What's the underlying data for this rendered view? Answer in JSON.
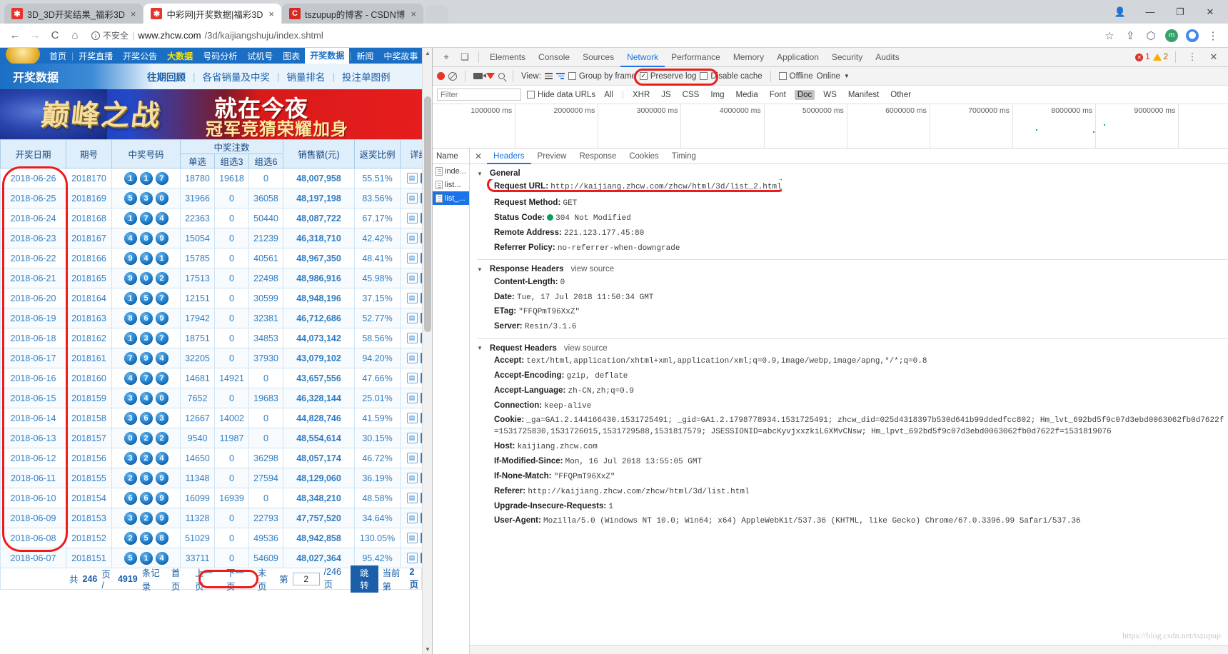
{
  "browser": {
    "tabs": [
      {
        "title": "3D_3D开奖结果_福彩3D",
        "favicon": "lottery-favicon",
        "active": false
      },
      {
        "title": "中彩网|开奖数据|福彩3D",
        "favicon": "lottery-favicon",
        "active": true
      },
      {
        "title": "tszupup的博客 - CSDN博",
        "favicon": "csdn-favicon",
        "active": false
      }
    ],
    "close_label": "×",
    "new_tab_label": "",
    "window": {
      "minimize": "—",
      "maximize": "❐",
      "close": "✕",
      "user": "👤"
    },
    "nav": {
      "back": "←",
      "forward": "→",
      "reload": "C",
      "home": "⌂"
    },
    "security_label": "不安全",
    "url_domain": "www.zhcw.com",
    "url_path": "/3d/kaijiangshuju/index.shtml",
    "star": "☆",
    "omni_icons": [
      "share-icon",
      "extension-icon",
      "profile-icon",
      "menu-icon"
    ]
  },
  "site": {
    "nav_items": [
      "首页",
      "开奖直播",
      "开奖公告",
      "大数据",
      "号码分析",
      "试机号",
      "图表",
      "开奖数据",
      "新闻",
      "中奖故事"
    ],
    "nav_active": "开奖数据",
    "nav_hot": "大数据",
    "subnav_title": "开奖数据",
    "subnav_links": [
      "往期回顾",
      "各省销量及中奖",
      "销量排名",
      "投注单图例"
    ],
    "banner": {
      "line1": "巅峰之战",
      "line2": "就在今夜",
      "line3": "冠军竞猜荣耀加身"
    }
  },
  "table": {
    "headers": {
      "date": "开奖日期",
      "issue": "期号",
      "numbers": "中奖号码",
      "bets_group": "中奖注数",
      "bet_single": "单选",
      "bet_g3": "组选3",
      "bet_g6": "组选6",
      "sales": "销售额(元)",
      "ratio": "返奖比例",
      "detail": "详细"
    },
    "rows": [
      {
        "date": "2018-06-26",
        "issue": "2018170",
        "balls": [
          "1",
          "1",
          "7"
        ],
        "single": "18780",
        "g3": "19618",
        "g6": "0",
        "sales": "48,007,958",
        "ratio": "55.51%"
      },
      {
        "date": "2018-06-25",
        "issue": "2018169",
        "balls": [
          "5",
          "3",
          "0"
        ],
        "single": "31966",
        "g3": "0",
        "g6": "36058",
        "sales": "48,197,198",
        "ratio": "83.56%"
      },
      {
        "date": "2018-06-24",
        "issue": "2018168",
        "balls": [
          "1",
          "7",
          "4"
        ],
        "single": "22363",
        "g3": "0",
        "g6": "50440",
        "sales": "48,087,722",
        "ratio": "67.17%"
      },
      {
        "date": "2018-06-23",
        "issue": "2018167",
        "balls": [
          "4",
          "8",
          "9"
        ],
        "single": "15054",
        "g3": "0",
        "g6": "21239",
        "sales": "46,318,710",
        "ratio": "42.42%"
      },
      {
        "date": "2018-06-22",
        "issue": "2018166",
        "balls": [
          "9",
          "4",
          "1"
        ],
        "single": "15785",
        "g3": "0",
        "g6": "40561",
        "sales": "48,967,350",
        "ratio": "48.41%"
      },
      {
        "date": "2018-06-21",
        "issue": "2018165",
        "balls": [
          "9",
          "0",
          "2"
        ],
        "single": "17513",
        "g3": "0",
        "g6": "22498",
        "sales": "48,986,916",
        "ratio": "45.98%"
      },
      {
        "date": "2018-06-20",
        "issue": "2018164",
        "balls": [
          "1",
          "5",
          "7"
        ],
        "single": "12151",
        "g3": "0",
        "g6": "30599",
        "sales": "48,948,196",
        "ratio": "37.15%"
      },
      {
        "date": "2018-06-19",
        "issue": "2018163",
        "balls": [
          "8",
          "6",
          "9"
        ],
        "single": "17942",
        "g3": "0",
        "g6": "32381",
        "sales": "46,712,686",
        "ratio": "52.77%"
      },
      {
        "date": "2018-06-18",
        "issue": "2018162",
        "balls": [
          "1",
          "3",
          "7"
        ],
        "single": "18751",
        "g3": "0",
        "g6": "34853",
        "sales": "44,073,142",
        "ratio": "58.56%"
      },
      {
        "date": "2018-06-17",
        "issue": "2018161",
        "balls": [
          "7",
          "9",
          "4"
        ],
        "single": "32205",
        "g3": "0",
        "g6": "37930",
        "sales": "43,079,102",
        "ratio": "94.20%"
      },
      {
        "date": "2018-06-16",
        "issue": "2018160",
        "balls": [
          "4",
          "7",
          "7"
        ],
        "single": "14681",
        "g3": "14921",
        "g6": "0",
        "sales": "43,657,556",
        "ratio": "47.66%"
      },
      {
        "date": "2018-06-15",
        "issue": "2018159",
        "balls": [
          "3",
          "4",
          "0"
        ],
        "single": "7652",
        "g3": "0",
        "g6": "19683",
        "sales": "46,328,144",
        "ratio": "25.01%"
      },
      {
        "date": "2018-06-14",
        "issue": "2018158",
        "balls": [
          "3",
          "6",
          "3"
        ],
        "single": "12667",
        "g3": "14002",
        "g6": "0",
        "sales": "44,828,746",
        "ratio": "41.59%"
      },
      {
        "date": "2018-06-13",
        "issue": "2018157",
        "balls": [
          "0",
          "2",
          "2"
        ],
        "single": "9540",
        "g3": "11987",
        "g6": "0",
        "sales": "48,554,614",
        "ratio": "30.15%"
      },
      {
        "date": "2018-06-12",
        "issue": "2018156",
        "balls": [
          "3",
          "2",
          "4"
        ],
        "single": "14650",
        "g3": "0",
        "g6": "36298",
        "sales": "48,057,174",
        "ratio": "46.72%"
      },
      {
        "date": "2018-06-11",
        "issue": "2018155",
        "balls": [
          "2",
          "8",
          "9"
        ],
        "single": "11348",
        "g3": "0",
        "g6": "27594",
        "sales": "48,129,060",
        "ratio": "36.19%"
      },
      {
        "date": "2018-06-10",
        "issue": "2018154",
        "balls": [
          "6",
          "6",
          "9"
        ],
        "single": "16099",
        "g3": "16939",
        "g6": "0",
        "sales": "48,348,210",
        "ratio": "48.58%"
      },
      {
        "date": "2018-06-09",
        "issue": "2018153",
        "balls": [
          "3",
          "2",
          "9"
        ],
        "single": "11328",
        "g3": "0",
        "g6": "22793",
        "sales": "47,757,520",
        "ratio": "34.64%"
      },
      {
        "date": "2018-06-08",
        "issue": "2018152",
        "balls": [
          "2",
          "5",
          "8"
        ],
        "single": "51029",
        "g3": "0",
        "g6": "49536",
        "sales": "48,942,858",
        "ratio": "130.05%"
      },
      {
        "date": "2018-06-07",
        "issue": "2018151",
        "balls": [
          "5",
          "1",
          "4"
        ],
        "single": "33711",
        "g3": "0",
        "g6": "54609",
        "sales": "48,027,364",
        "ratio": "95.42%"
      }
    ]
  },
  "pager": {
    "total_prefix": "共",
    "total_pages": "246",
    "pages_unit": "页 /",
    "total_records": "4919",
    "records_unit": "条记录",
    "first": "首页",
    "prev": "上一页",
    "next": "下一页",
    "last": "末页",
    "jump_prefix": "第",
    "jump_value": "2",
    "jump_suffix": "/246页",
    "jump_button": "跳转",
    "current_prefix": "当前第",
    "current_page": "2页"
  },
  "devtools": {
    "panels": [
      "Elements",
      "Console",
      "Sources",
      "Network",
      "Performance",
      "Memory",
      "Application",
      "Security",
      "Audits"
    ],
    "active_panel": "Network",
    "errors": "1",
    "warnings": "2",
    "more_icon": "⋮",
    "close_icon": "✕",
    "toolbar": {
      "view_label": "View:",
      "group_by_frame": "Group by frame",
      "preserve_log": "Preserve log",
      "disable_cache": "Disable cache",
      "offline": "Offline",
      "online": "Online",
      "throttle_caret": "▼"
    },
    "filterbar": {
      "filter_placeholder": "Filter",
      "hide_data_urls": "Hide data URLs",
      "types": [
        "All",
        "XHR",
        "JS",
        "CSS",
        "Img",
        "Media",
        "Font",
        "Doc",
        "WS",
        "Manifest",
        "Other"
      ],
      "active_type": "Doc"
    },
    "timeline_ticks": [
      "1000000 ms",
      "2000000 ms",
      "3000000 ms",
      "4000000 ms",
      "5000000 ms",
      "6000000 ms",
      "7000000 ms",
      "8000000 ms",
      "9000000 ms"
    ],
    "name_column": "Name",
    "requests": [
      {
        "name": "inde...",
        "selected": false
      },
      {
        "name": "list...",
        "selected": false
      },
      {
        "name": "list_...",
        "selected": true
      }
    ],
    "detail_tabs": [
      "Headers",
      "Preview",
      "Response",
      "Cookies",
      "Timing"
    ],
    "active_detail_tab": "Headers",
    "general": {
      "title": "General",
      "rows": [
        {
          "key": "Request URL:",
          "value": "http://kaijiang.zhcw.com/zhcw/html/3d/list_2.html",
          "highlight": true
        },
        {
          "key": "Request Method:",
          "value": "GET"
        },
        {
          "key": "Status Code:",
          "value": "304 Not Modified",
          "status": true
        },
        {
          "key": "Remote Address:",
          "value": "221.123.177.45:80"
        },
        {
          "key": "Referrer Policy:",
          "value": "no-referrer-when-downgrade"
        }
      ]
    },
    "response_headers": {
      "title": "Response Headers",
      "view_source": "view source",
      "rows": [
        {
          "key": "Content-Length:",
          "value": "0"
        },
        {
          "key": "Date:",
          "value": "Tue, 17 Jul 2018 11:50:34 GMT"
        },
        {
          "key": "ETag:",
          "value": "\"FFQPmT96XxZ\""
        },
        {
          "key": "Server:",
          "value": "Resin/3.1.6"
        }
      ]
    },
    "request_headers": {
      "title": "Request Headers",
      "view_source": "view source",
      "rows": [
        {
          "key": "Accept:",
          "value": "text/html,application/xhtml+xml,application/xml;q=0.9,image/webp,image/apng,*/*;q=0.8"
        },
        {
          "key": "Accept-Encoding:",
          "value": "gzip, deflate"
        },
        {
          "key": "Accept-Language:",
          "value": "zh-CN,zh;q=0.9"
        },
        {
          "key": "Connection:",
          "value": "keep-alive"
        },
        {
          "key": "Cookie:",
          "value": "_ga=GA1.2.144166430.1531725491; _gid=GA1.2.1798778934.1531725491; zhcw_did=025d4318397b530d641b99ddedfcc802; Hm_lvt_692bd5f9c07d3ebd0063062fb0d7622f=1531725830,1531726015,1531729588,1531817579; JSESSIONID=abcKyvjxxzkiL6XMvCNsw; Hm_lpvt_692bd5f9c07d3ebd0063062fb0d7622f=1531819076"
        },
        {
          "key": "Host:",
          "value": "kaijiang.zhcw.com"
        },
        {
          "key": "If-Modified-Since:",
          "value": "Mon, 16 Jul 2018 13:55:05 GMT"
        },
        {
          "key": "If-None-Match:",
          "value": "\"FFQPmT96XxZ\""
        },
        {
          "key": "Referer:",
          "value": "http://kaijiang.zhcw.com/zhcw/html/3d/list.html"
        },
        {
          "key": "Upgrade-Insecure-Requests:",
          "value": "1"
        },
        {
          "key": "User-Agent:",
          "value": "Mozilla/5.0 (Windows NT 10.0; Win64; x64) AppleWebKit/537.36 (KHTML, like Gecko) Chrome/67.0.3396.99 Safari/537.36"
        }
      ]
    },
    "watermark": "https://blog.csdn.net/tszupup"
  }
}
